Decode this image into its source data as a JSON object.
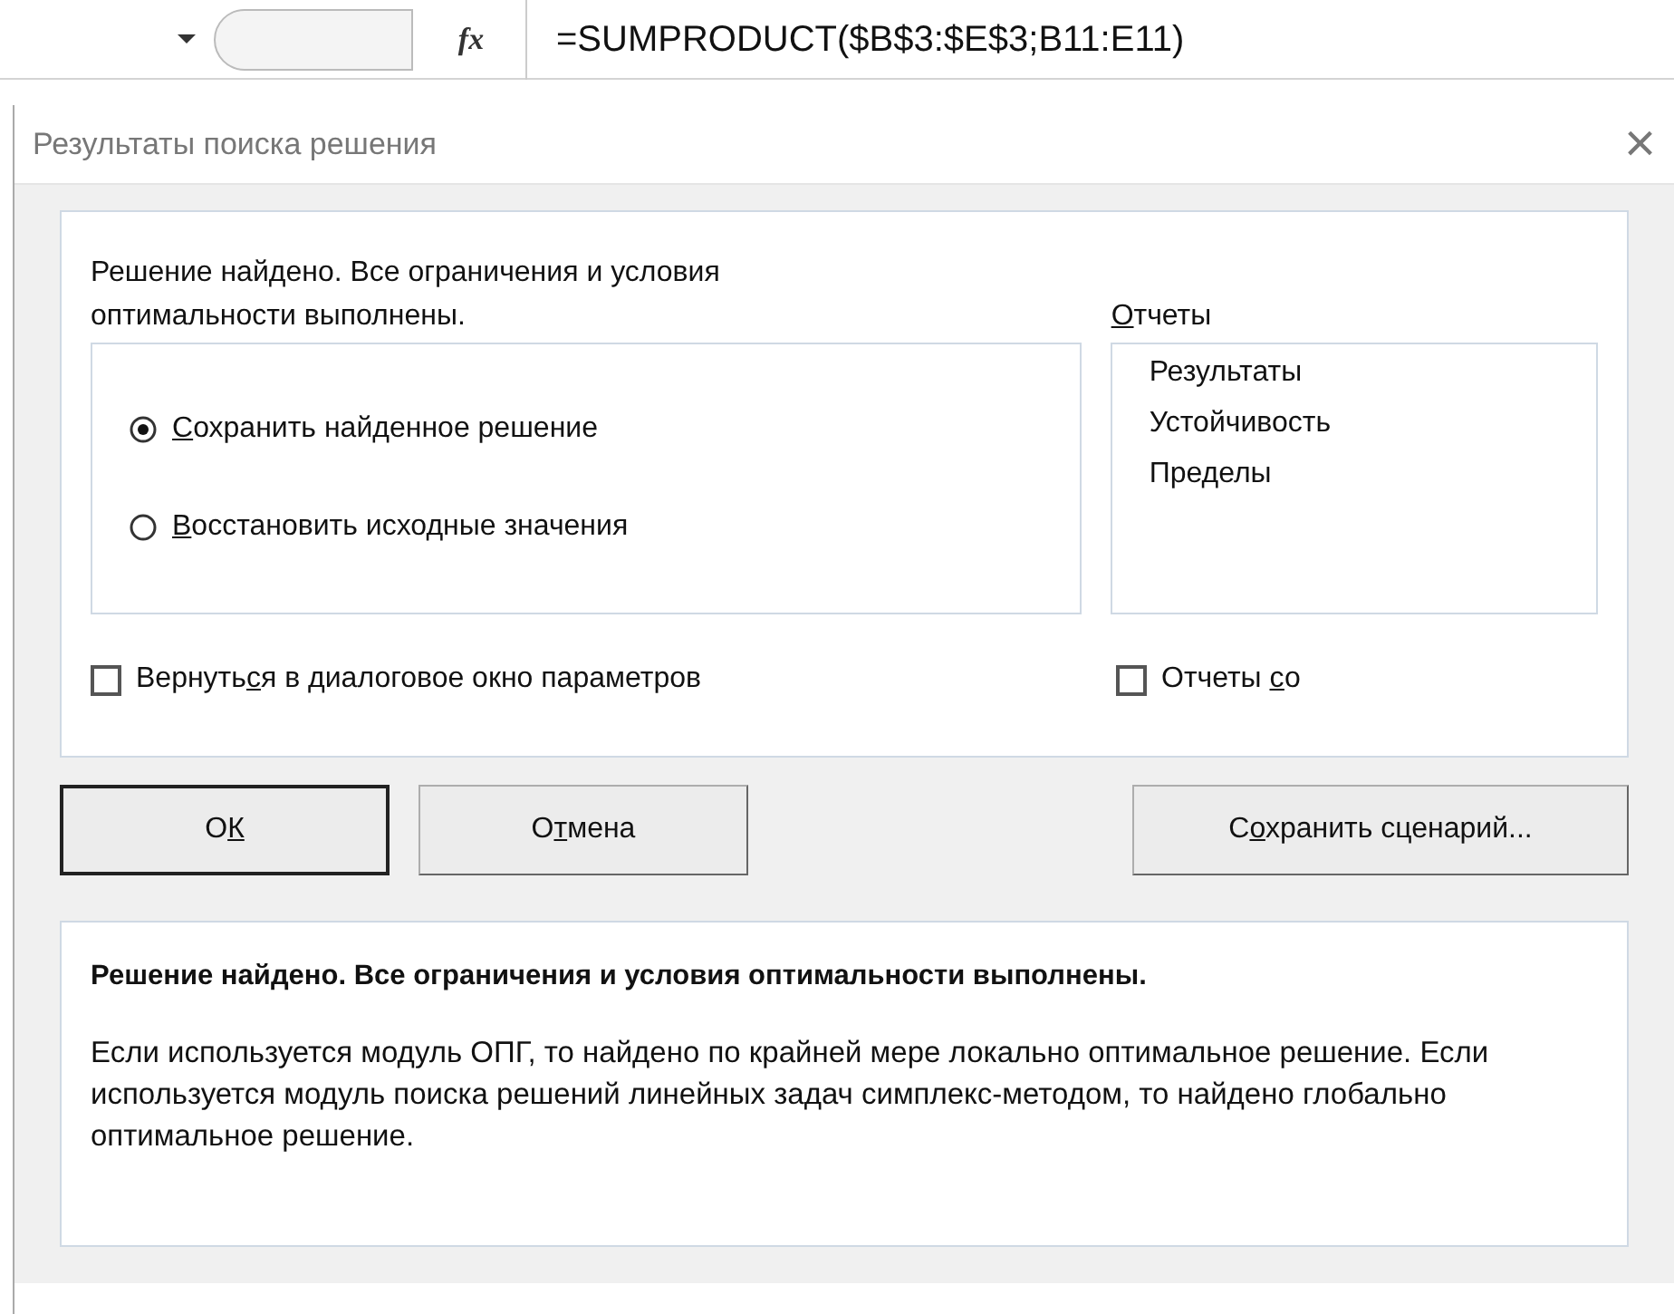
{
  "formula_bar": {
    "fx": "fx",
    "formula": "=SUMPRODUCT($B$3:$E$3;B11:E11)"
  },
  "dialog": {
    "title": "Результаты поиска решения",
    "close": "×",
    "message": "Решение найдено. Все ограничения и условия оптимальности выполнены.",
    "options": [
      {
        "parts": {
          "key": "С",
          "post": "охранить найденное решение"
        },
        "selected": true
      },
      {
        "parts": {
          "key": "В",
          "post": "осстановить исходные значения"
        },
        "selected": false
      }
    ],
    "return_checkbox": {
      "parts": {
        "pre": "Вернуть",
        "key": "с",
        "post": "я в диалоговое окно параметров"
      },
      "checked": false
    },
    "reports": {
      "label_parts": {
        "key": "О",
        "post": "тчеты"
      },
      "items": [
        "Результаты",
        "Устойчивость",
        "Пределы"
      ]
    },
    "outline_checkbox": {
      "parts": {
        "pre": "Отчеты ",
        "key": "с",
        "post": "о"
      },
      "checked": false
    },
    "buttons": [
      {
        "parts": {
          "pre": "О",
          "key": "К"
        },
        "default": true
      },
      {
        "parts": {
          "pre": "О",
          "key": "т",
          "post": "мена"
        },
        "default": false
      }
    ],
    "save_button": {
      "parts": {
        "pre": "С",
        "key": "о",
        "post": "хранить сценарий..."
      }
    },
    "info_title": "Решение найдено. Все ограничения и условия оптимальности выполнены.",
    "info_text": "Если используется модуль ОПГ, то найдено по крайней мере локально оптимальное решение. Если используется модуль поиска решений линейных задач симплекс-методом, то найдено глобально оптимальное решение."
  }
}
